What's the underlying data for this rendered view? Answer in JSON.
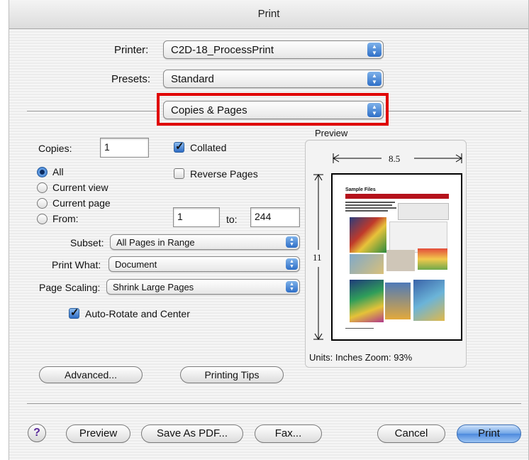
{
  "window": {
    "title": "Print"
  },
  "printer": {
    "label": "Printer:",
    "value": "C2D-18_ProcessPrint"
  },
  "presets": {
    "label": "Presets:",
    "value": "Standard"
  },
  "panel": {
    "value": "Copies & Pages"
  },
  "copies": {
    "label": "Copies:",
    "value": "1"
  },
  "collated": {
    "label": "Collated",
    "checked": true
  },
  "reverse_pages": {
    "label": "Reverse Pages",
    "checked": false
  },
  "range": {
    "options": [
      "All",
      "Current view",
      "Current page",
      "From:"
    ],
    "selected": "All",
    "from_value": "1",
    "to_label": "to:",
    "to_value": "244"
  },
  "subset": {
    "label": "Subset:",
    "value": "All Pages in Range"
  },
  "print_what": {
    "label": "Print What:",
    "value": "Document"
  },
  "page_scaling": {
    "label": "Page Scaling:",
    "value": "Shrink Large Pages"
  },
  "auto_rotate": {
    "label": "Auto-Rotate and Center",
    "checked": true
  },
  "preview": {
    "title": "Preview",
    "width_label": "8.5",
    "height_label": "11",
    "page_heading": "Sample Files",
    "units_text": "Units: Inches  Zoom:  93%"
  },
  "buttons": {
    "advanced": "Advanced...",
    "printing_tips": "Printing Tips",
    "help": "?",
    "preview": "Preview",
    "save_pdf": "Save As PDF...",
    "fax": "Fax...",
    "cancel": "Cancel",
    "print": "Print"
  },
  "colors": {
    "highlight": "#e00000",
    "accent": "#2e6cc4",
    "title_bar": "#b5121b"
  }
}
